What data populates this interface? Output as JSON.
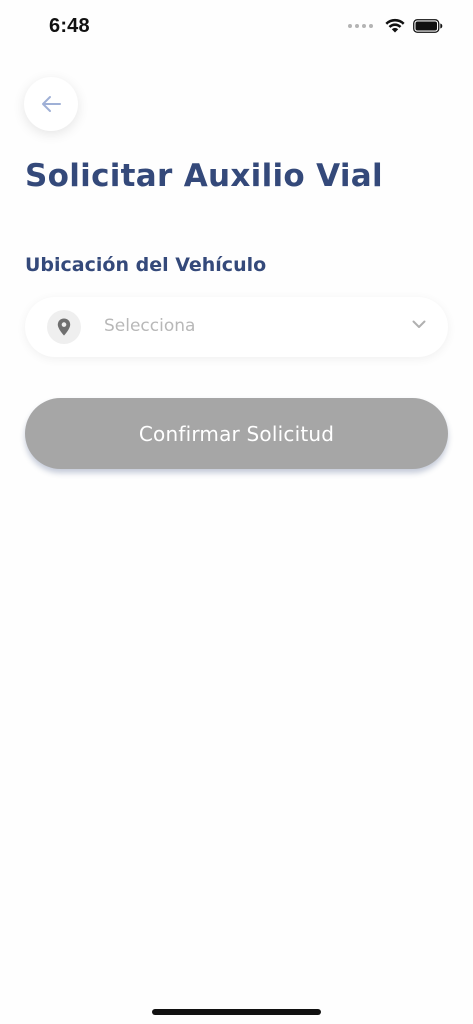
{
  "status_bar": {
    "time": "6:48",
    "icons": [
      "signal-dots-icon",
      "wifi-icon",
      "battery-icon"
    ]
  },
  "header": {
    "back_icon": "arrow-left-icon",
    "title": "Solicitar Auxilio Vial"
  },
  "form": {
    "location_label": "Ubicación del Vehículo",
    "location_select": {
      "icon": "location-pin-icon",
      "value": "Selecciona",
      "chevron": "chevron-down-icon"
    },
    "confirm_label": "Confirmar Solicitud"
  },
  "colors": {
    "primary_text": "#34497a",
    "back_arrow": "#9fb0d6",
    "placeholder": "#b8b8b8",
    "disabled_button": "#a6a6a6"
  }
}
